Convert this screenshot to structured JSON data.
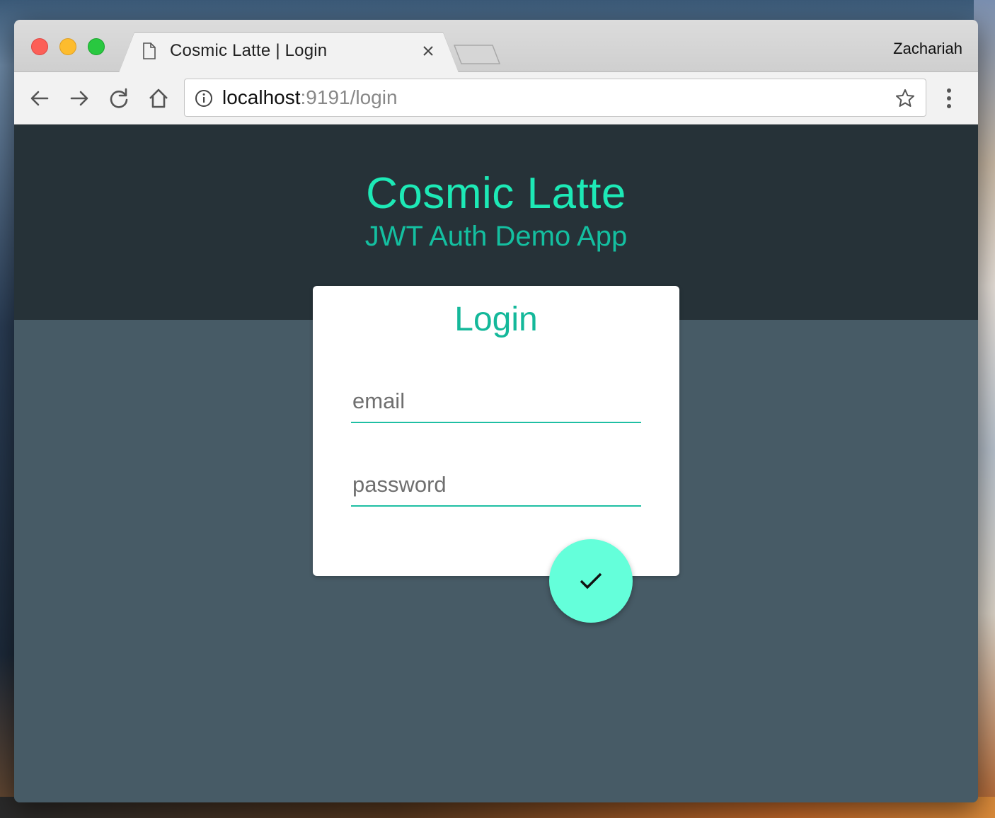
{
  "browser": {
    "tab_title": "Cosmic Latte | Login",
    "profile_name": "Zachariah",
    "url_host": "localhost",
    "url_rest": ":9191/login"
  },
  "header": {
    "title": "Cosmic Latte",
    "subtitle": "JWT Auth Demo App"
  },
  "login_card": {
    "title": "Login",
    "email_placeholder": "email",
    "password_placeholder": "password",
    "submit_icon": "check-icon"
  },
  "colors": {
    "accent": "#1de9b6",
    "header_bg": "#263238",
    "body_bg": "#475b66",
    "fab_bg": "#64ffda"
  }
}
